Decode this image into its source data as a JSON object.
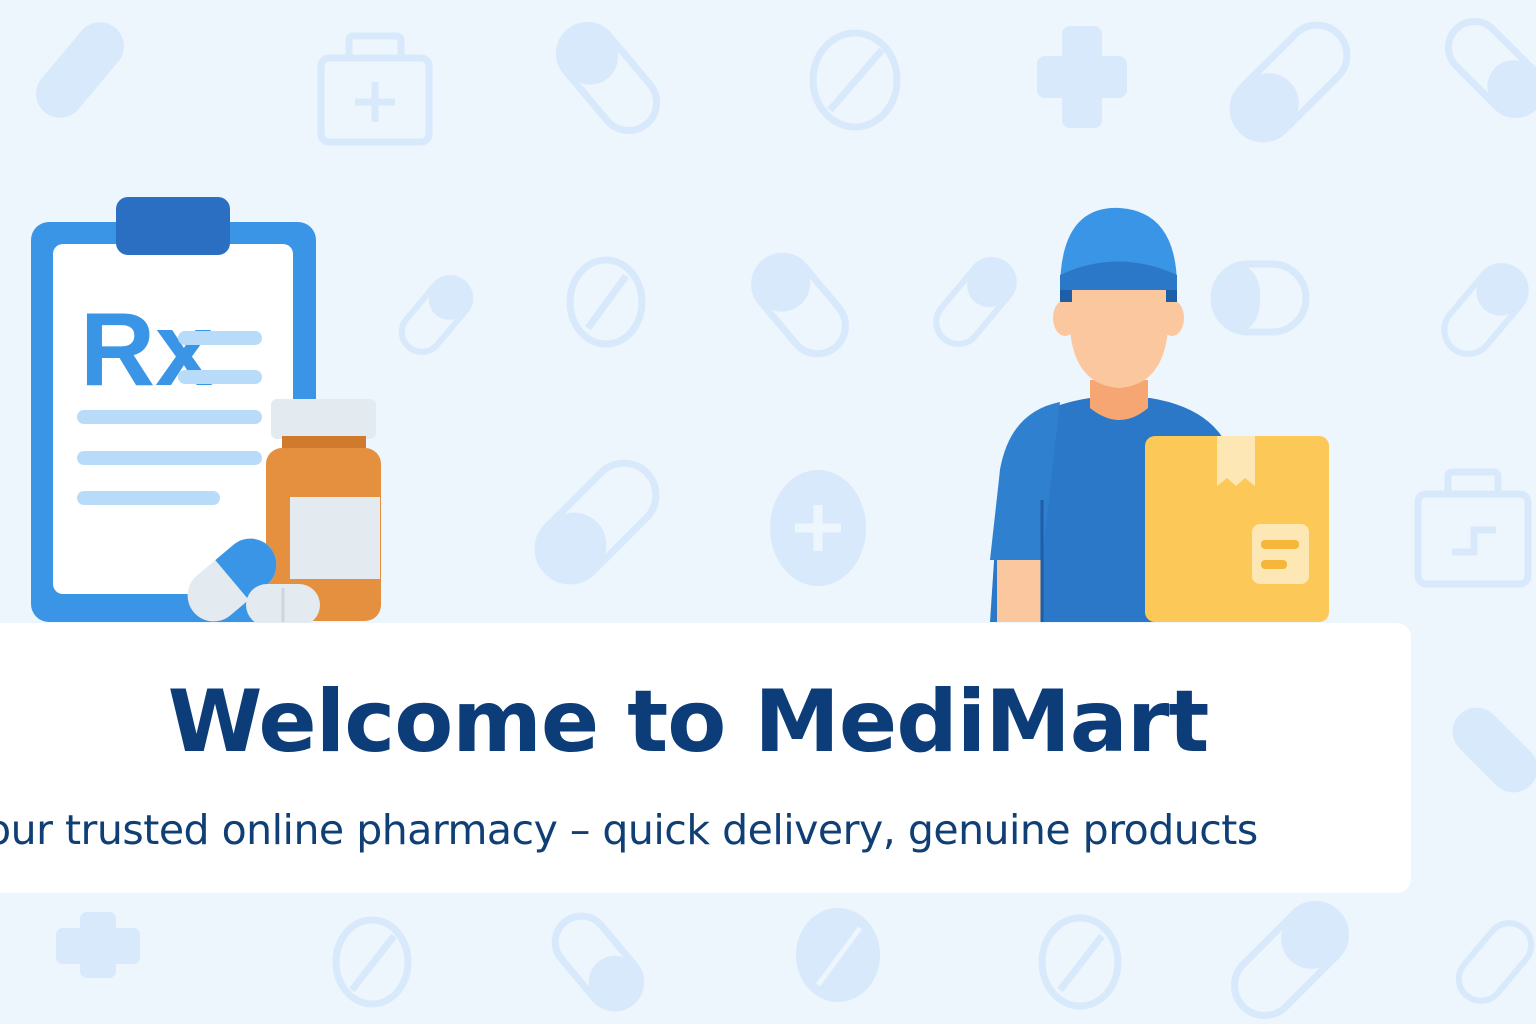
{
  "hero": {
    "title": "Welcome to MediMart",
    "subtitle": "our trusted online pharmacy – quick delivery, genuine products"
  },
  "illustrations": {
    "prescription": {
      "symbol": "Rx",
      "icon": "clipboard-prescription-icon"
    },
    "delivery": {
      "icon": "delivery-person-with-package"
    },
    "background_icons": [
      "pill-icon",
      "tablet-icon",
      "plus-icon",
      "first-aid-kit-icon"
    ]
  },
  "colors": {
    "background": "#edf5fd",
    "pattern_icon": "#d7e9fb",
    "title": "#0d3d78",
    "accent_blue": "#3b95e6",
    "bottle_orange": "#e5903f",
    "package_yellow": "#fcc858",
    "card": "#ffffff"
  }
}
